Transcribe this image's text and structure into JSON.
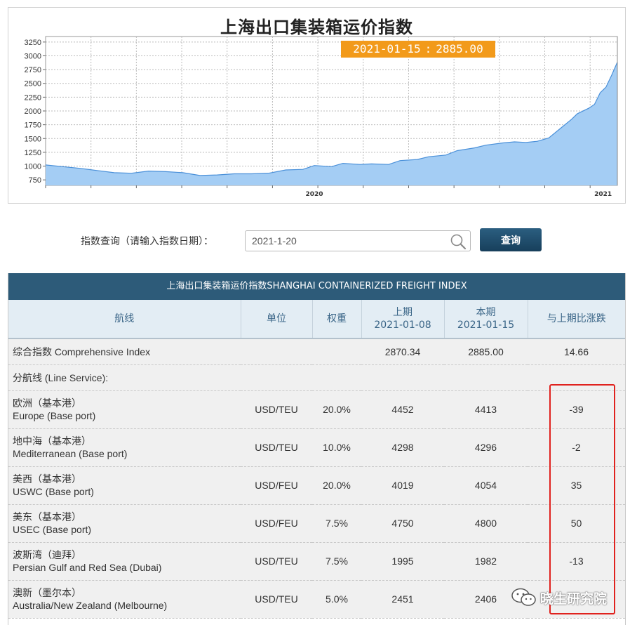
{
  "chart_data": {
    "type": "area",
    "title": "上海出口集装箱运价指数",
    "yticks": [
      750,
      1000,
      1250,
      1500,
      1750,
      2000,
      2250,
      2500,
      2750,
      3000,
      3250
    ],
    "ylim": [
      650,
      3350
    ],
    "xlim": [
      0,
      100
    ],
    "xtick_labels": [
      {
        "label": "2020",
        "x": 47
      },
      {
        "label": "2021",
        "x": 97.5
      }
    ],
    "x": [
      0,
      3,
      6,
      9,
      12,
      15,
      18,
      21,
      24,
      27,
      30,
      33,
      36,
      39,
      42,
      45,
      47,
      50,
      52,
      55,
      57,
      60,
      62,
      65,
      67,
      70,
      72,
      75,
      77,
      80,
      82,
      84,
      86,
      88,
      90,
      92,
      93,
      95,
      96,
      97,
      98,
      99,
      100
    ],
    "values": [
      1020,
      990,
      960,
      920,
      880,
      870,
      910,
      900,
      880,
      830,
      840,
      860,
      860,
      870,
      930,
      940,
      1010,
      990,
      1050,
      1030,
      1040,
      1030,
      1100,
      1120,
      1170,
      1200,
      1280,
      1330,
      1380,
      1420,
      1440,
      1430,
      1450,
      1510,
      1680,
      1850,
      1950,
      2050,
      2120,
      2330,
      2430,
      2650,
      2885
    ],
    "tooltip": {
      "date": "2021-01-15",
      "sep": ":",
      "value": "2885.00"
    },
    "colors": {
      "fill": "#a4cdf4",
      "line": "#4a90d9",
      "grid": "#bbbbbb",
      "tooltip_bg": "#f29a1a"
    }
  },
  "query": {
    "label": "指数查询（请输入指数日期）：",
    "input_value": "2021-1-20",
    "button_label": "查询"
  },
  "table": {
    "caption": "上海出口集装箱运价指数SHANGHAI CONTAINERIZED FREIGHT INDEX",
    "headers": {
      "route": "航线",
      "unit": "单位",
      "weight": "权重",
      "prev_label": "上期",
      "prev_date": "2021-01-08",
      "curr_label": "本期",
      "curr_date": "2021-01-15",
      "change": "与上期比涨跌"
    },
    "composite": {
      "name": "综合指数 Comprehensive Index",
      "prev": "2870.34",
      "curr": "2885.00",
      "change": "14.66"
    },
    "line_service_label": "分航线 (Line Service):",
    "rows": [
      {
        "cn": "欧洲（基本港）",
        "en": "Europe (Base port)",
        "unit": "USD/TEU",
        "weight": "20.0%",
        "prev": "4452",
        "curr": "4413",
        "change": "-39"
      },
      {
        "cn": "地中海（基本港）",
        "en": "Mediterranean (Base port)",
        "unit": "USD/TEU",
        "weight": "10.0%",
        "prev": "4298",
        "curr": "4296",
        "change": "-2"
      },
      {
        "cn": "美西（基本港）",
        "en": "USWC (Base port)",
        "unit": "USD/FEU",
        "weight": "20.0%",
        "prev": "4019",
        "curr": "4054",
        "change": "35"
      },
      {
        "cn": "美东（基本港）",
        "en": "USEC (Base port)",
        "unit": "USD/FEU",
        "weight": "7.5%",
        "prev": "4750",
        "curr": "4800",
        "change": "50"
      },
      {
        "cn": "波斯湾（迪拜）",
        "en": "Persian Gulf and Red Sea (Dubai)",
        "unit": "USD/TEU",
        "weight": "7.5%",
        "prev": "1995",
        "curr": "1982",
        "change": "-13"
      },
      {
        "cn": "澳新（墨尔本）",
        "en": "Australia/New Zealand (Melbourne)",
        "unit": "USD/TEU",
        "weight": "5.0%",
        "prev": "2451",
        "curr": "2406",
        "change": ""
      }
    ]
  },
  "watermark": {
    "text": "晓生研究院",
    "icon": "wechat-icon"
  }
}
